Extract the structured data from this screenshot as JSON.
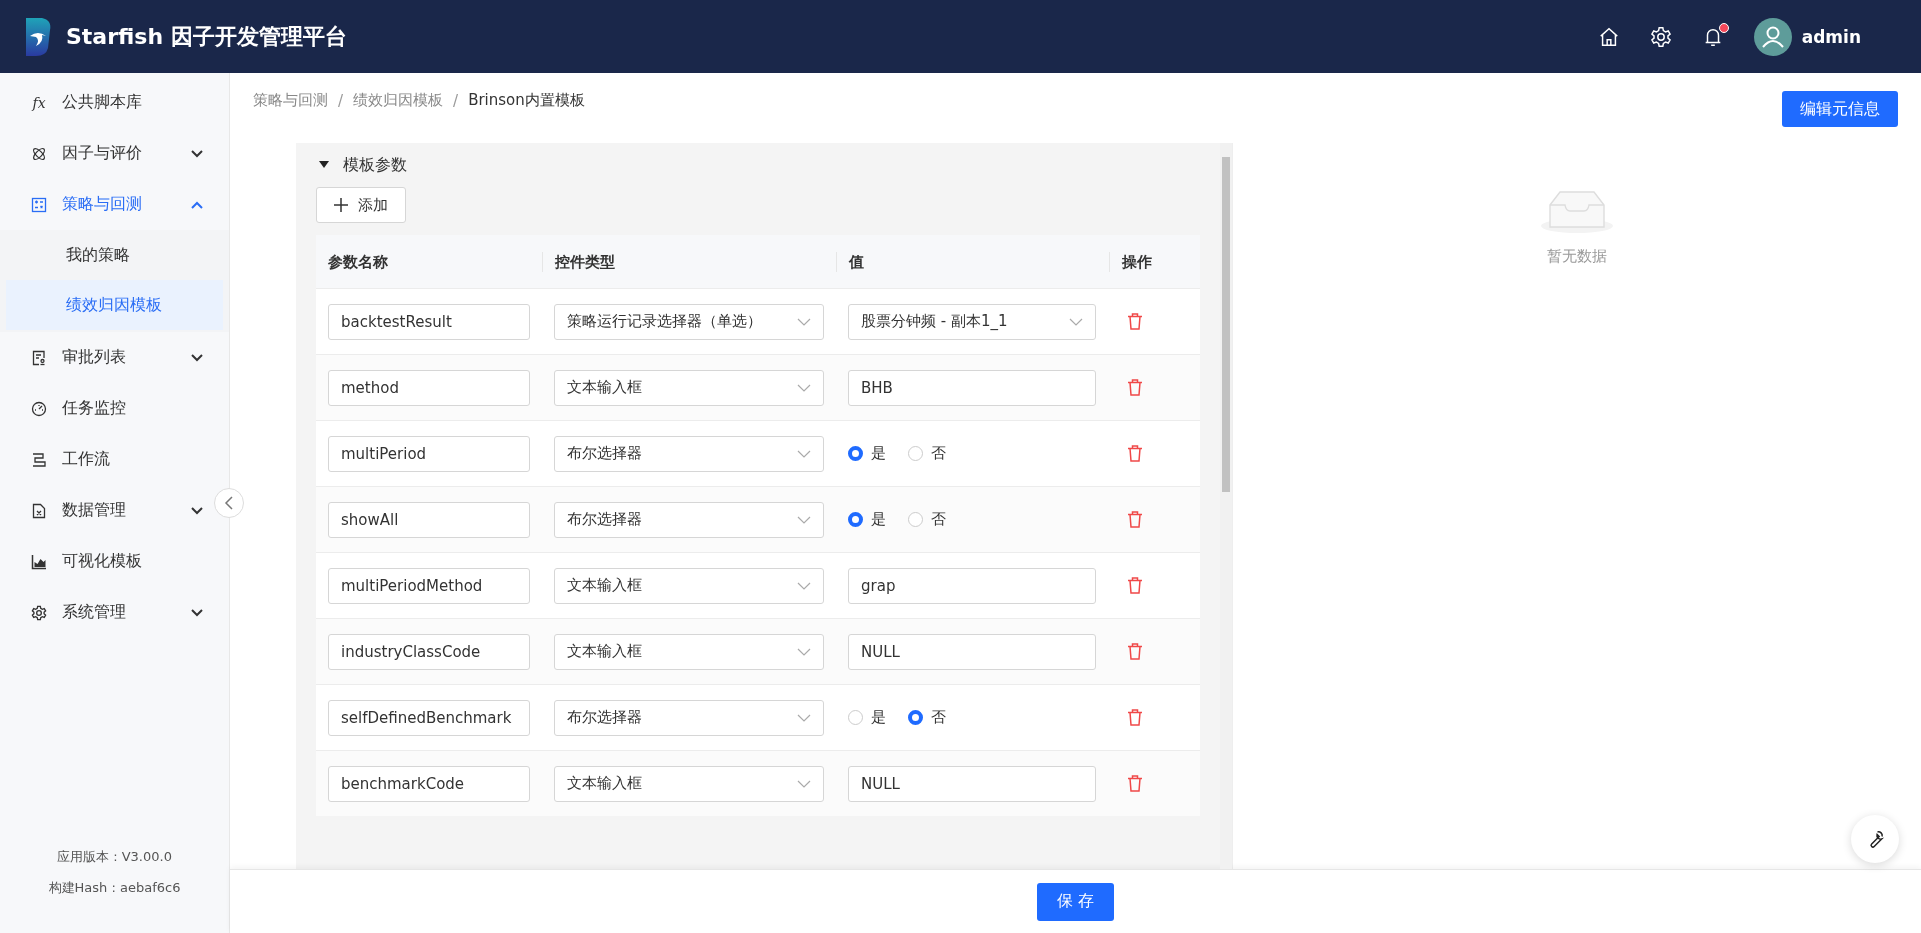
{
  "header": {
    "brand": "Starfish 因子开发管理平台",
    "user": "admin",
    "notification_dot": true
  },
  "sidebar": {
    "items": [
      {
        "label": "公共脚本库",
        "icon_text": "fx",
        "selected": false
      },
      {
        "label": "因子与评价",
        "selected": false,
        "expanded": false
      },
      {
        "label": "策略与回测",
        "selected": true,
        "expanded": true,
        "children": [
          {
            "label": "我的策略",
            "selected": false
          },
          {
            "label": "绩效归因模板",
            "selected": true
          }
        ]
      },
      {
        "label": "审批列表",
        "selected": false,
        "expanded": false
      },
      {
        "label": "任务监控",
        "selected": false
      },
      {
        "label": "工作流",
        "selected": false
      },
      {
        "label": "数据管理",
        "selected": false,
        "expanded": false
      },
      {
        "label": "可视化模板",
        "selected": false
      },
      {
        "label": "系统管理",
        "selected": false,
        "expanded": false
      }
    ],
    "version": "应用版本 : V3.00.0",
    "build": "构建Hash : aebaf6c6"
  },
  "breadcrumb": {
    "items": [
      "策略与回测",
      "绩效归因模板",
      "Brinson内置模板"
    ],
    "separators": [
      "/",
      "/"
    ]
  },
  "edit_button": "编辑元信息",
  "panel": {
    "title": "模板参数",
    "expanded": true,
    "add_button": "添加",
    "columns": [
      "参数名称",
      "控件类型",
      "值",
      "操作"
    ],
    "rows": [
      {
        "name": "backtestResult",
        "type": "策略运行记录选择器（单选）",
        "kind": "select",
        "value": "股票分钟频 - 副本1_1"
      },
      {
        "name": "method",
        "type": "文本输入框",
        "kind": "text",
        "value": "BHB"
      },
      {
        "name": "multiPeriod",
        "type": "布尔选择器",
        "kind": "bool",
        "options": [
          {
            "label": "是",
            "selected": true
          },
          {
            "label": "否",
            "selected": false
          }
        ]
      },
      {
        "name": "showAll",
        "type": "布尔选择器",
        "kind": "bool",
        "options": [
          {
            "label": "是",
            "selected": true
          },
          {
            "label": "否",
            "selected": false
          }
        ]
      },
      {
        "name": "multiPeriodMethod",
        "type": "文本输入框",
        "kind": "text",
        "value": "grap"
      },
      {
        "name": "industryClassCode",
        "type": "文本输入框",
        "kind": "text",
        "value": "NULL"
      },
      {
        "name": "selfDefinedBenchmark",
        "type": "布尔选择器",
        "kind": "bool",
        "options": [
          {
            "label": "是",
            "selected": false
          },
          {
            "label": "否",
            "selected": true
          }
        ]
      },
      {
        "name": "benchmarkCode",
        "type": "文本输入框",
        "kind": "text",
        "value": "NULL"
      }
    ]
  },
  "empty_state": "暂无数据",
  "save_button": "保 存"
}
